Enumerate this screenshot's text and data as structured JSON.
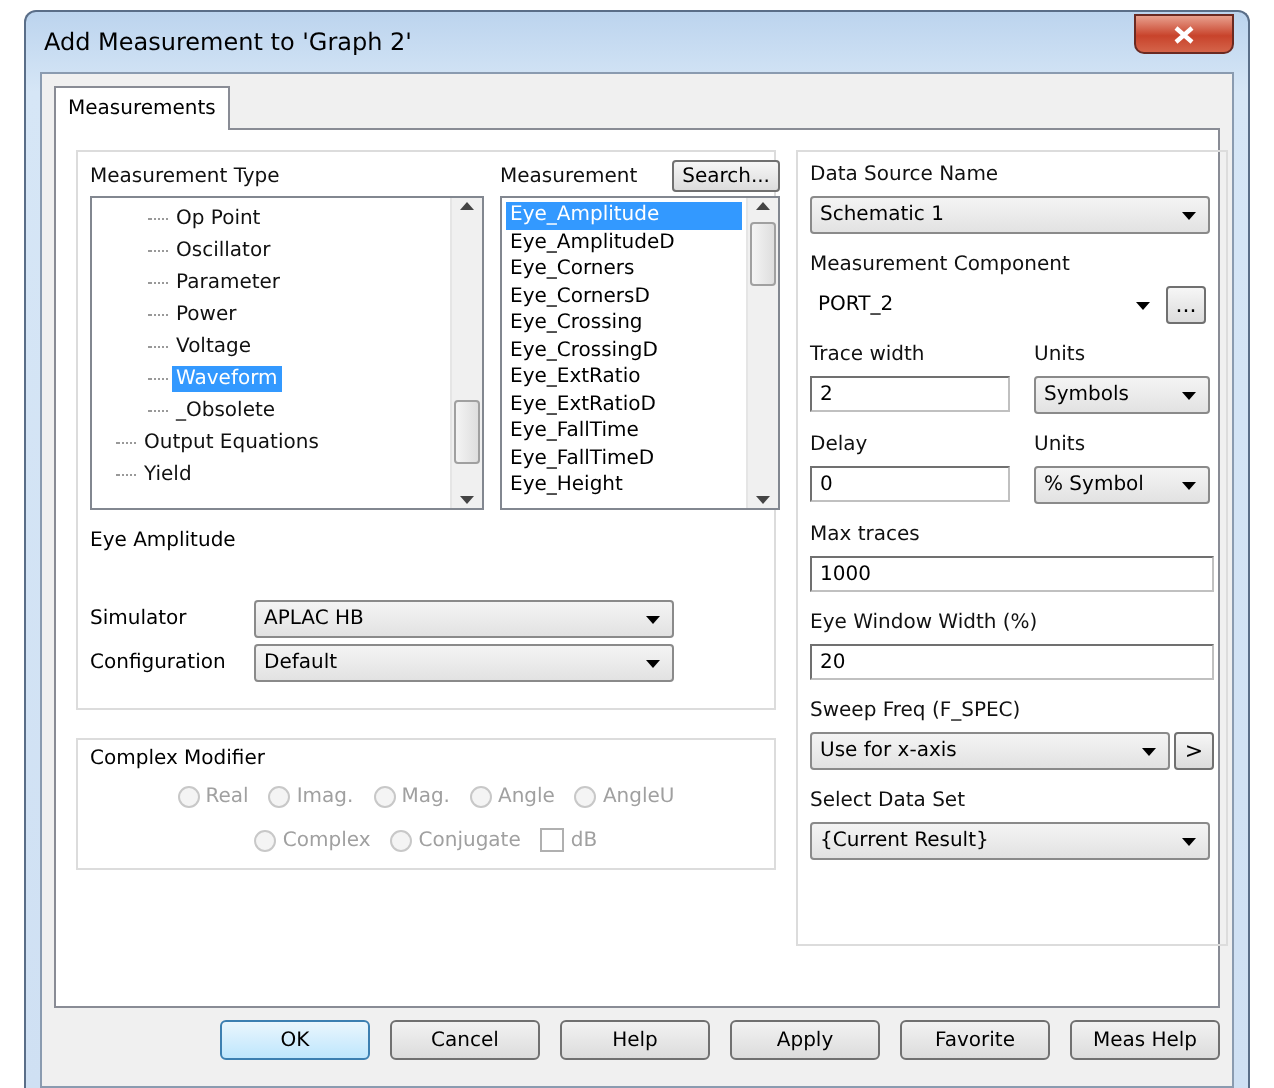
{
  "window": {
    "title": "Add Measurement to 'Graph 2'"
  },
  "tabs": [
    {
      "label": "Measurements",
      "selected": true
    }
  ],
  "measurement_type": {
    "label": "Measurement Type",
    "items": [
      {
        "children": [
          {
            "label": "Op Point",
            "selected": false
          },
          {
            "label": "Oscillator",
            "selected": false
          },
          {
            "label": "Parameter",
            "selected": false
          },
          {
            "label": "Power",
            "selected": false
          },
          {
            "label": "Voltage",
            "selected": false
          },
          {
            "label": "Waveform",
            "selected": true
          },
          {
            "label": "_Obsolete",
            "selected": false
          }
        ]
      },
      {
        "label": "Output Equations",
        "selected": false
      },
      {
        "label": "Yield",
        "selected": false
      }
    ]
  },
  "measurement": {
    "label": "Measurement",
    "search_button": "Search...",
    "items": [
      {
        "label": "Eye_Amplitude",
        "selected": true
      },
      {
        "label": "Eye_AmplitudeD",
        "selected": false
      },
      {
        "label": "Eye_Corners",
        "selected": false
      },
      {
        "label": "Eye_CornersD",
        "selected": false
      },
      {
        "label": "Eye_Crossing",
        "selected": false
      },
      {
        "label": "Eye_CrossingD",
        "selected": false
      },
      {
        "label": "Eye_ExtRatio",
        "selected": false
      },
      {
        "label": "Eye_ExtRatioD",
        "selected": false
      },
      {
        "label": "Eye_FallTime",
        "selected": false
      },
      {
        "label": "Eye_FallTimeD",
        "selected": false
      },
      {
        "label": "Eye_Height",
        "selected": false
      }
    ]
  },
  "description": "Eye Amplitude",
  "simulator": {
    "label": "Simulator",
    "value": "APLAC HB"
  },
  "configuration": {
    "label": "Configuration",
    "value": "Default"
  },
  "complex_modifier": {
    "title": "Complex Modifier",
    "disabled": true,
    "options": [
      {
        "kind": "radio",
        "label": "Real",
        "selected": false
      },
      {
        "kind": "radio",
        "label": "Imag.",
        "selected": false
      },
      {
        "kind": "radio",
        "label": "Mag.",
        "selected": false
      },
      {
        "kind": "radio",
        "label": "Angle",
        "selected": false
      },
      {
        "kind": "radio",
        "label": "AngleU",
        "selected": false
      },
      {
        "kind": "radio",
        "label": "Complex",
        "selected": false
      },
      {
        "kind": "radio",
        "label": "Conjugate",
        "selected": false
      },
      {
        "kind": "checkbox",
        "label": "dB",
        "checked": false
      }
    ]
  },
  "right_fields": [
    {
      "kind": "combo",
      "label": "Data Source Name",
      "value": "Schematic 1"
    },
    {
      "kind": "combo_dots",
      "label": "Measurement Component",
      "value": "PORT_2",
      "button": "..."
    },
    {
      "kind": "pair",
      "label": "Trace width",
      "value": "2",
      "units_label": "Units",
      "units": "Symbols"
    },
    {
      "kind": "pair",
      "label": "Delay",
      "value": "0",
      "units_label": "Units",
      "units": "% Symbol"
    },
    {
      "kind": "text",
      "label": "Max traces",
      "value": "1000"
    },
    {
      "kind": "text",
      "label": "Eye Window Width (%)",
      "value": "20"
    },
    {
      "kind": "combo_arrow",
      "label": "Sweep Freq (F_SPEC)",
      "value": "Use for x-axis",
      "button": ">"
    },
    {
      "kind": "combo",
      "label": "Select Data Set",
      "value": "{Current Result}"
    }
  ],
  "buttons": [
    {
      "label": "OK",
      "default": true
    },
    {
      "label": "Cancel",
      "default": false
    },
    {
      "label": "Help",
      "default": false
    },
    {
      "label": "Apply",
      "default": false
    },
    {
      "label": "Favorite",
      "default": false
    },
    {
      "label": "Meas Help",
      "default": false
    }
  ]
}
